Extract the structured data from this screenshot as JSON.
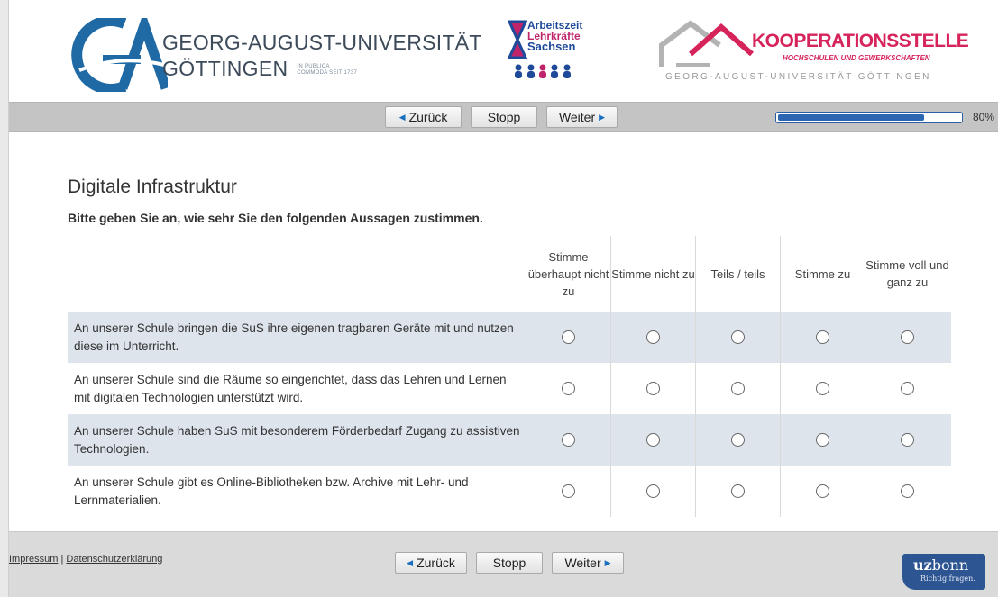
{
  "header": {
    "uni_line1": "GEORG-AUGUST-UNIVERSITÄT",
    "uni_line2": "GÖTTINGEN",
    "uni_motto": "IN PUBLICA COMMODA SEIT 1737",
    "sachsen_line1": "Arbeitszeit",
    "sachsen_line2": "Lehrkräfte",
    "sachsen_line3": "Sachsen",
    "koop_title": "KOOPERATIONSSTELLE",
    "koop_sub": "HOCHSCHULEN UND GEWERKSCHAFTEN",
    "koop_uni": "GEORG-AUGUST-UNIVERSITÄT GÖTTINGEN"
  },
  "nav": {
    "back": "Zurück",
    "stop": "Stopp",
    "next": "Weiter",
    "progress_value": 0.8,
    "progress_label": "80%"
  },
  "question": {
    "title": "Digitale Infrastruktur",
    "instruction": "Bitte geben Sie an, wie sehr Sie den folgenden Aussagen zustimmen.",
    "columns": [
      "Stimme überhaupt nicht zu",
      "Stimme nicht zu",
      "Teils / teils",
      "Stimme zu",
      "Stimme voll und ganz zu"
    ],
    "items": [
      "An unserer Schule bringen die SuS ihre eigenen tragbaren Geräte mit und nutzen diese im Unterricht.",
      "An unserer Schule sind die Räume so eingerichtet, dass das Lehren und Lernen mit digitalen Technologien unterstützt wird.",
      "An unserer Schule haben SuS mit besonderem Förderbedarf Zugang zu assistiven Technologien.",
      "An unserer Schule gibt es Online-Bibliotheken bzw. Archive mit Lehr- und Lernmaterialien."
    ]
  },
  "footer": {
    "impressum": "Impressum",
    "separator": "|",
    "datenschutz": "Datenschutzerklärung",
    "brand_main_bold": "uz",
    "brand_main": "bonn",
    "brand_sub": "Richtig fragen."
  },
  "colors": {
    "accent_blue": "#2b66b3",
    "row_shade": "#dde4ec",
    "koop_red": "#d6245b"
  }
}
